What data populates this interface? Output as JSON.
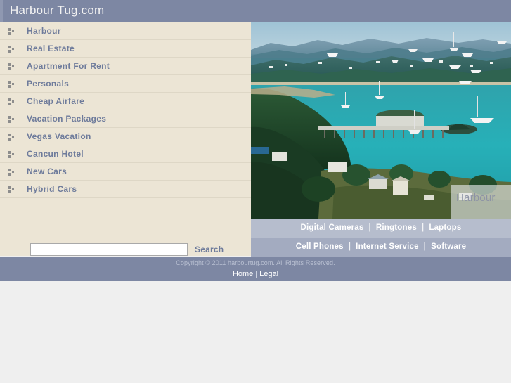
{
  "header": {
    "site_title": "Harbour Tug.com",
    "background_color": "#7d87a3",
    "title_color": "#f2f2f2"
  },
  "sidebar": {
    "background_color": "#ece5d5",
    "link_color": "#6e7b9b",
    "bullet_icon": "list-bullet-icon",
    "items": [
      {
        "label": "Harbour"
      },
      {
        "label": "Real Estate"
      },
      {
        "label": "Apartment For Rent"
      },
      {
        "label": "Personals"
      },
      {
        "label": "Cheap Airfare"
      },
      {
        "label": "Vacation Packages"
      },
      {
        "label": "Vegas Vacation"
      },
      {
        "label": "Cancun Hotel"
      },
      {
        "label": "New Cars"
      },
      {
        "label": "Hybrid Cars"
      }
    ]
  },
  "search": {
    "value": "",
    "placeholder": "",
    "button_label": "Search"
  },
  "hero": {
    "alt": "harbour-bay-panorama-photo",
    "watermark_text": "Harbour"
  },
  "nav_bars": [
    {
      "background_color": "#b6bdcd",
      "links": [
        "Digital Cameras",
        "Ringtones",
        "Laptops"
      ],
      "separator": "|"
    },
    {
      "background_color": "#a3abc0",
      "links": [
        "Cell Phones",
        "Internet Service",
        "Software"
      ],
      "separator": "|"
    }
  ],
  "footer": {
    "background_color": "#7d87a3",
    "copyright": "Copyright © 2011 harbourtug.com. All Rights Reserved.",
    "links": [
      "Home",
      "Legal"
    ],
    "separator": "|"
  }
}
